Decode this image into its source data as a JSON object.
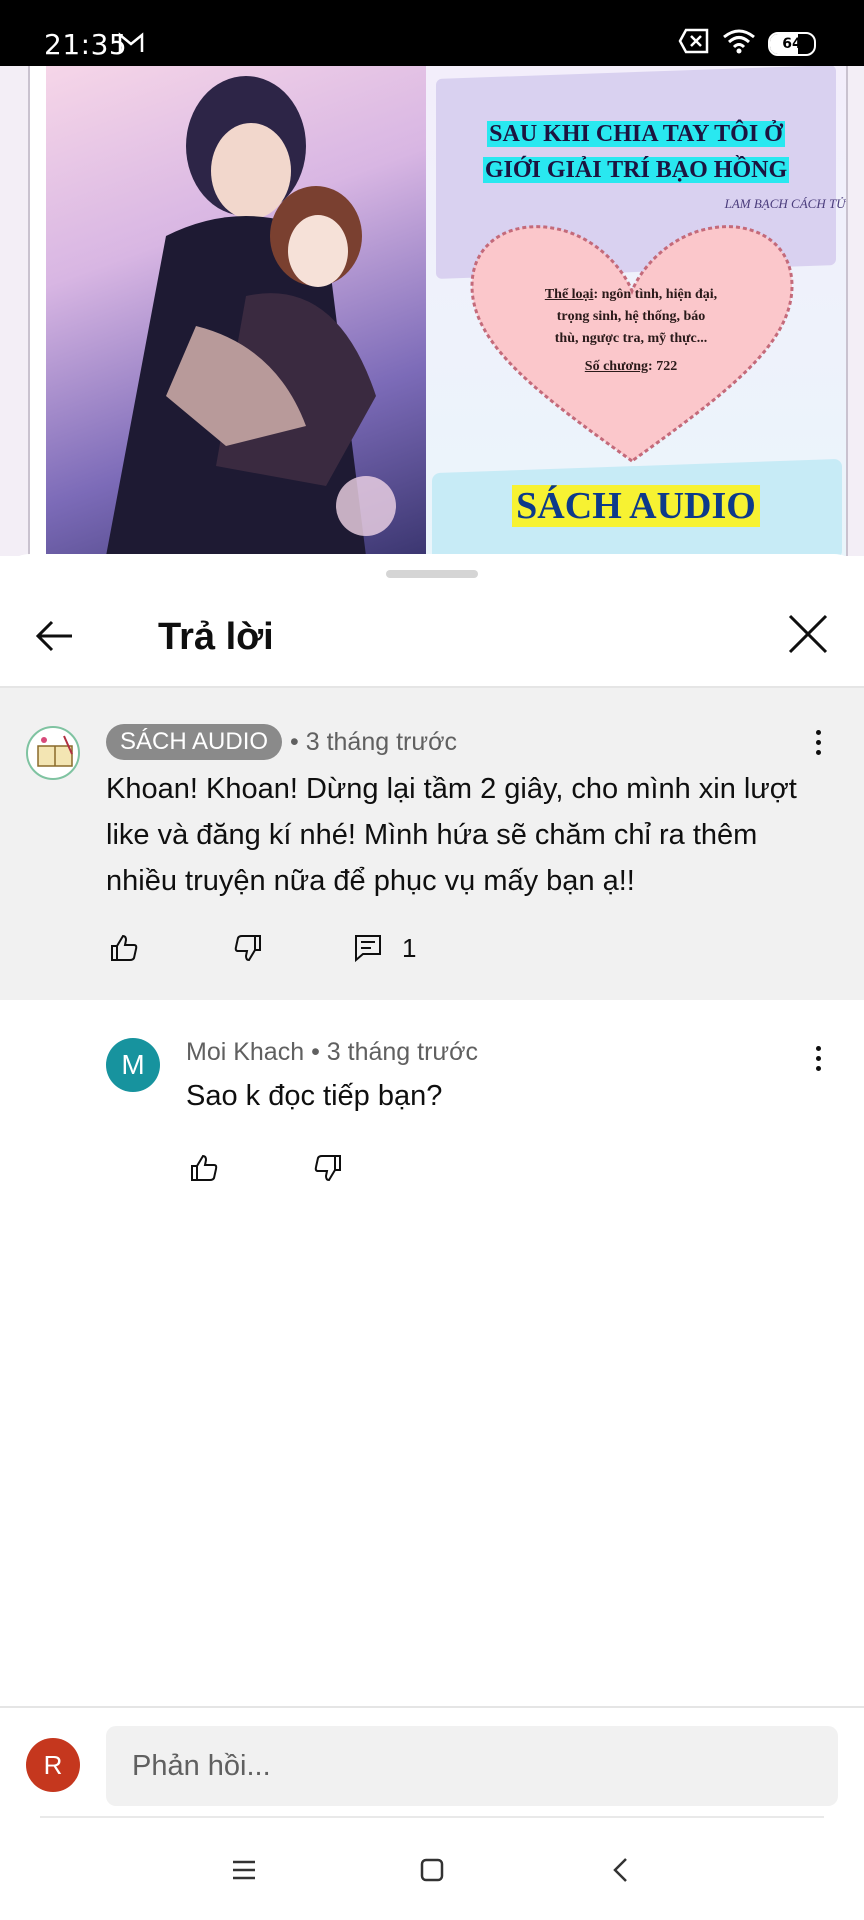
{
  "status_bar": {
    "time": "21:35",
    "battery": "64",
    "battery_level": 0.64
  },
  "video": {
    "title_line1": "SAU KHI CHIA TAY TÔI Ở",
    "title_line2": "GIỚI GIẢI TRÍ BẠO HỒNG",
    "author": "LAM BẠCH CÁCH TỬ",
    "genre_label": "Thể loại",
    "genre_line1": ": ngôn tình, hiện đại,",
    "genre_line2": "trọng sinh, hệ thống, báo",
    "genre_line3": "thù, ngược tra, mỹ thực...",
    "chapters_label": "Số chương",
    "chapters_value": ": 722",
    "audio_label": "SÁCH AUDIO"
  },
  "header": {
    "title": "Trả lời"
  },
  "parent_comment": {
    "author": "SÁCH AUDIO",
    "time": "• 3 tháng trước",
    "text": "Khoan! Khoan! Dừng lại tầm 2 giây, cho mình xin lượt like và đăng kí nhé! Mình hứa sẽ chăm chỉ ra thêm nhiều truyện nữa để phục vụ mấy bạn ạ!!",
    "reply_count": "1"
  },
  "reply": {
    "avatar_letter": "M",
    "author": "Moi Khach",
    "time": "• 3 tháng trước",
    "text": "Sao k đọc tiếp bạn?"
  },
  "composer": {
    "avatar_letter": "R",
    "placeholder": "Phản hồi..."
  },
  "colors": {
    "reply_avatar": "#17939e",
    "user_avatar": "#c5371e",
    "chip": "#8a8a8a",
    "highlight_bg": "#f1f1f1"
  }
}
